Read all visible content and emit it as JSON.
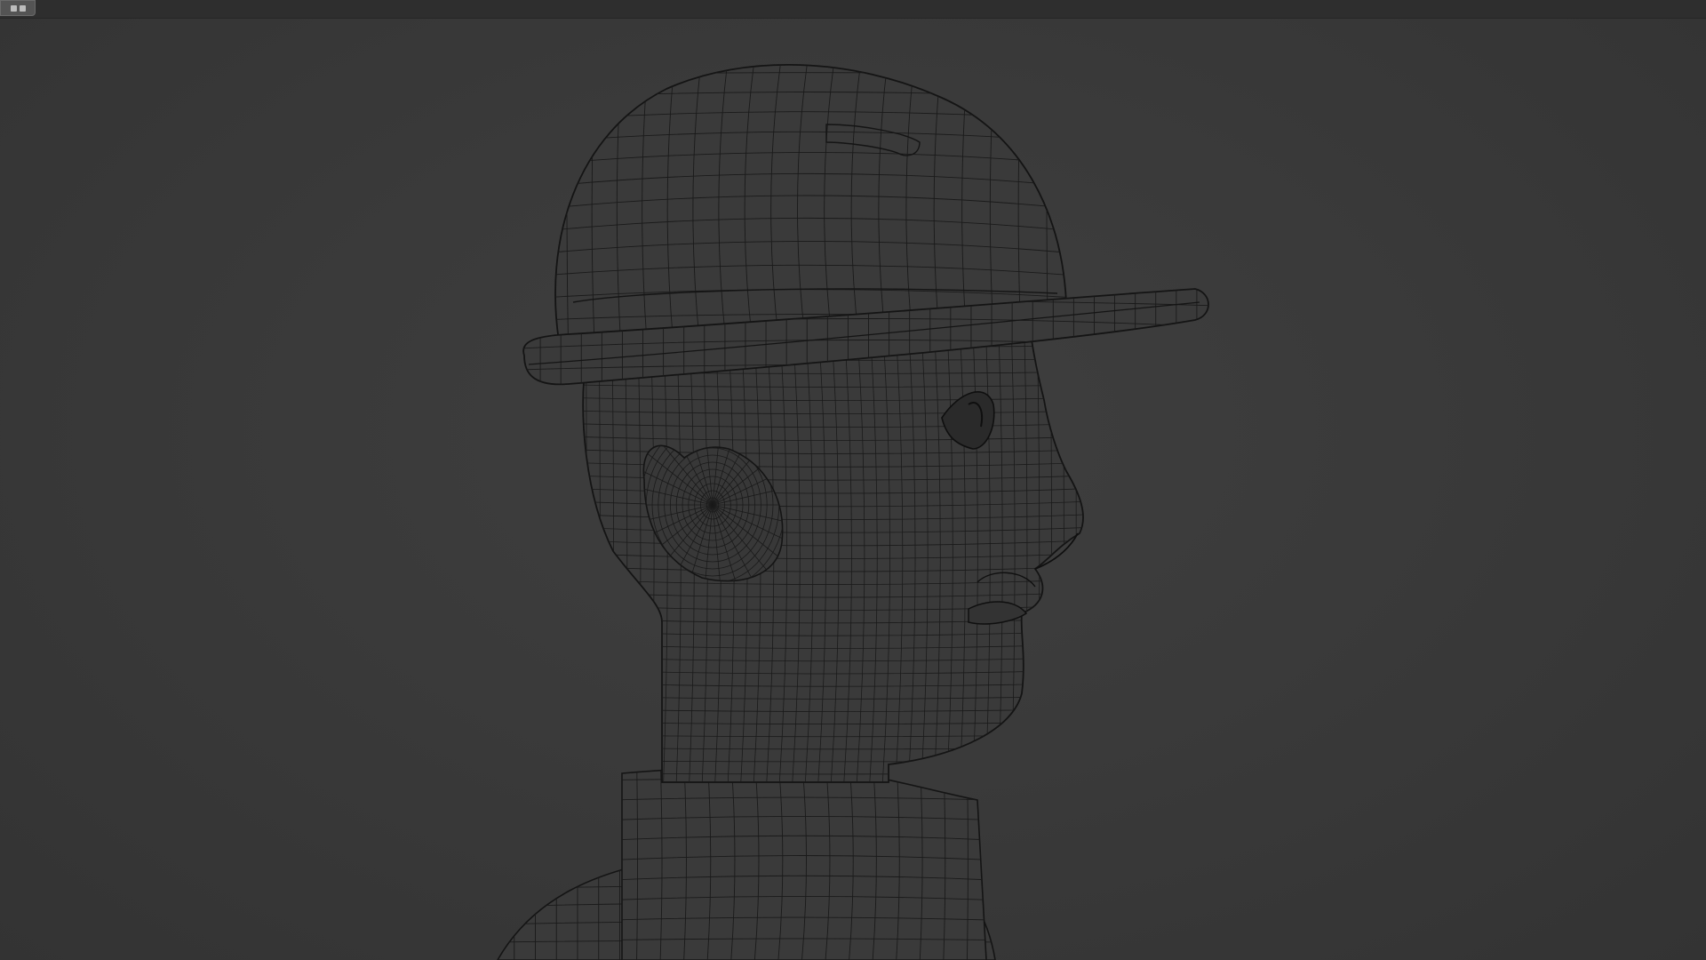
{
  "viewport": {
    "background": "#3a3a3a",
    "wire_color": "#141414",
    "mesh_fill": "#3a3a3a",
    "subject": "wireframe-character-head-side-profile-with-hard-hat"
  },
  "header": {
    "editor_type_icon": "editor-type-grid-icon"
  }
}
